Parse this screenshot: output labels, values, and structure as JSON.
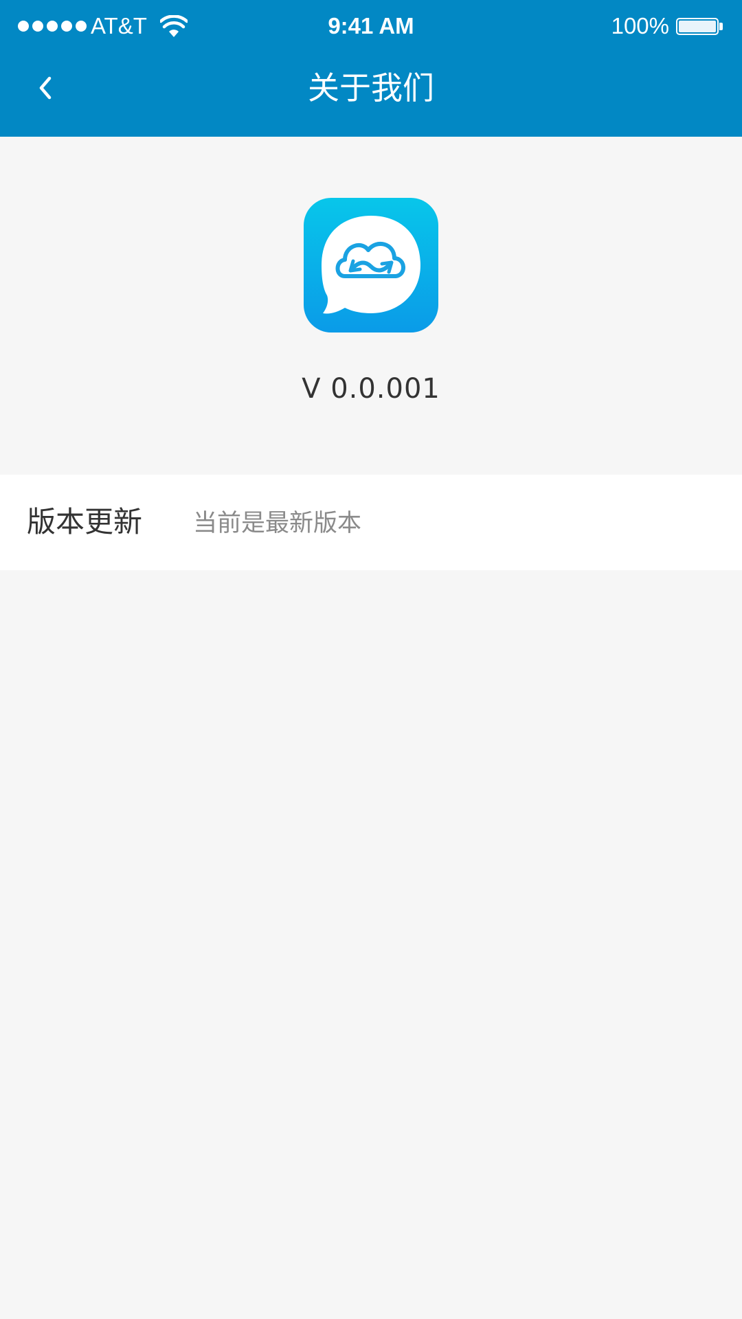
{
  "status_bar": {
    "carrier": "AT&T",
    "time": "9:41 AM",
    "battery_percent": "100%",
    "battery_level": 1.0,
    "signal_strength": 5
  },
  "nav": {
    "back_icon": "chevron-left-icon",
    "title": "关于我们"
  },
  "about": {
    "app_icon": "cloud-sync-chat-icon",
    "version": "V 0.0.001"
  },
  "update_row": {
    "label": "版本更新",
    "status": "当前是最新版本"
  },
  "colors": {
    "header_bg": "#0288c4",
    "page_bg": "#f6f6f6",
    "icon_gradient_top": "#08c6ea",
    "icon_gradient_bottom": "#0a9be8",
    "primary_text": "#333333",
    "secondary_text": "#8a8a8a"
  }
}
